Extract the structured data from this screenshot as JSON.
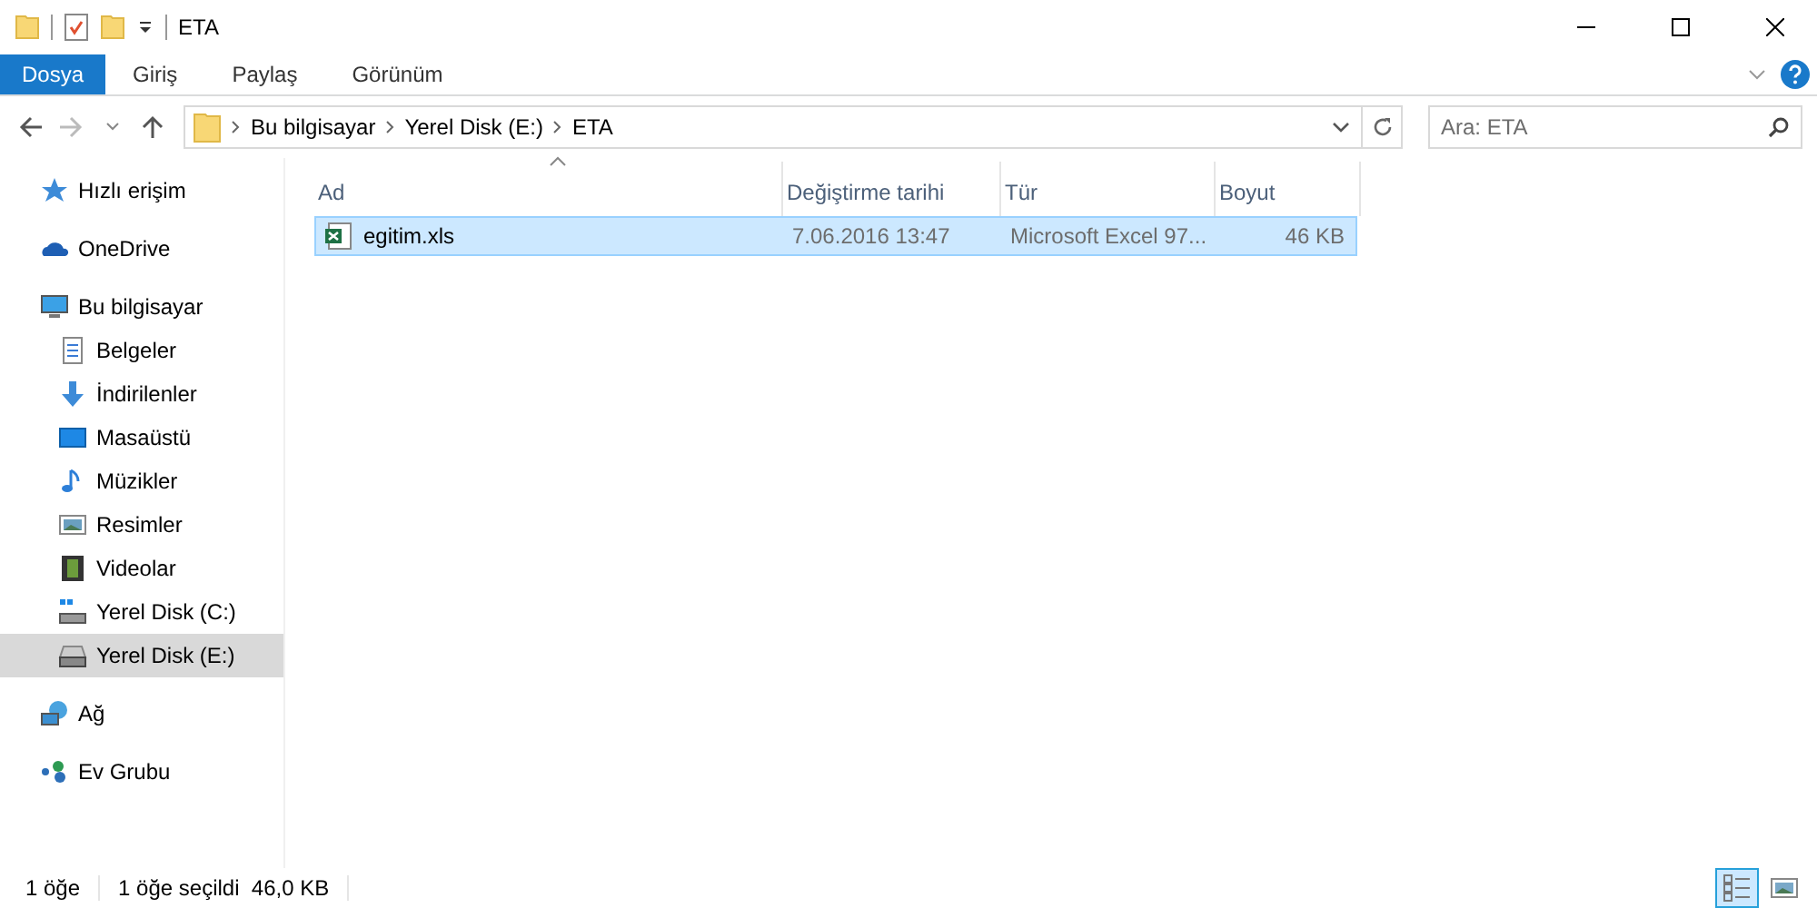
{
  "window": {
    "title": "ETA"
  },
  "ribbon_tabs": [
    {
      "label": "Dosya",
      "selected": true
    },
    {
      "label": "Giriş",
      "selected": false
    },
    {
      "label": "Paylaş",
      "selected": false
    },
    {
      "label": "Görünüm",
      "selected": false
    }
  ],
  "breadcrumb": [
    "Bu bilgisayar",
    "Yerel Disk (E:)",
    "ETA"
  ],
  "search": {
    "placeholder": "Ara: ETA"
  },
  "sidebar": {
    "items": [
      {
        "label": "Hızlı erişim",
        "selected": false
      },
      {
        "label": "OneDrive",
        "selected": false
      },
      {
        "label": "Bu bilgisayar",
        "selected": false,
        "children": [
          {
            "label": "Belgeler",
            "selected": false
          },
          {
            "label": "İndirilenler",
            "selected": false
          },
          {
            "label": "Masaüstü",
            "selected": false
          },
          {
            "label": "Müzikler",
            "selected": false
          },
          {
            "label": "Resimler",
            "selected": false
          },
          {
            "label": "Videolar",
            "selected": false
          },
          {
            "label": "Yerel Disk (C:)",
            "selected": false
          },
          {
            "label": "Yerel Disk (E:)",
            "selected": true
          }
        ]
      },
      {
        "label": "Ağ",
        "selected": false
      },
      {
        "label": "Ev Grubu",
        "selected": false
      }
    ]
  },
  "table": {
    "columns": [
      {
        "label": "Ad",
        "sorted": true
      },
      {
        "label": "Değiştirme tarihi",
        "sorted": false
      },
      {
        "label": "Tür",
        "sorted": false
      },
      {
        "label": "Boyut",
        "sorted": false
      }
    ],
    "rows": [
      {
        "name": "egitim.xls",
        "modified": "7.06.2016 13:47",
        "type": "Microsoft Excel 97...",
        "size": "46 KB",
        "selected": true
      }
    ]
  },
  "status_bar": {
    "count": "1 öğe",
    "selection": "1 öğe seçildi  46,0 KB"
  },
  "view_buttons": [
    {
      "selected": true
    },
    {
      "selected": false
    }
  ]
}
